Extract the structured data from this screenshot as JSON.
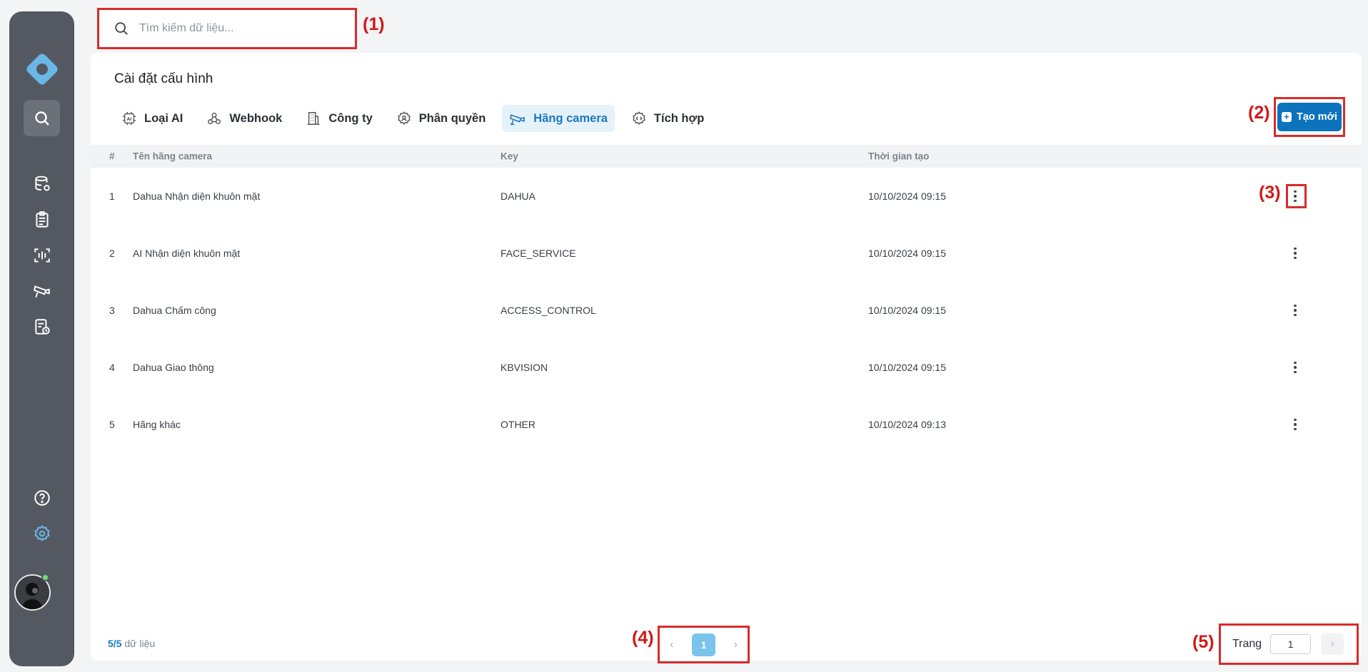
{
  "search": {
    "placeholder": "Tìm kiếm dữ liệu..."
  },
  "annotations": {
    "a1": "(1)",
    "a2": "(2)",
    "a3": "(3)",
    "a4": "(4)",
    "a5": "(5)"
  },
  "page": {
    "title": "Cài đặt cấu hình"
  },
  "tabs": [
    {
      "label": "Loại AI",
      "icon": "ai-chip-icon"
    },
    {
      "label": "Webhook",
      "icon": "webhook-icon"
    },
    {
      "label": "Công ty",
      "icon": "building-icon"
    },
    {
      "label": "Phân quyền",
      "icon": "gear-users-icon"
    },
    {
      "label": "Hãng camera",
      "icon": "camera-icon",
      "active": true
    },
    {
      "label": "Tích hợp",
      "icon": "integration-icon"
    }
  ],
  "create_button": {
    "label": "Tạo mới"
  },
  "table": {
    "headers": {
      "num": "#",
      "name": "Tên hãng camera",
      "key": "Key",
      "time": "Thời gian tạo"
    },
    "rows": [
      {
        "num": "1",
        "name": "Dahua Nhận diện khuôn mặt",
        "key": "DAHUA",
        "time": "10/10/2024 09:15"
      },
      {
        "num": "2",
        "name": "AI Nhận diện khuôn mặt",
        "key": "FACE_SERVICE",
        "time": "10/10/2024 09:15"
      },
      {
        "num": "3",
        "name": "Dahua Chấm công",
        "key": "ACCESS_CONTROL",
        "time": "10/10/2024 09:15"
      },
      {
        "num": "4",
        "name": "Dahua Giao thông",
        "key": "KBVISION",
        "time": "10/10/2024 09:15"
      },
      {
        "num": "5",
        "name": "Hãng khác",
        "key": "OTHER",
        "time": "10/10/2024 09:13"
      }
    ]
  },
  "footer": {
    "count": "5",
    "total": "/5",
    "suffix": " dữ liệu",
    "current_page": "1",
    "goto_label": "Trang",
    "goto_value": "1"
  },
  "colors": {
    "accent": "#0d73bd",
    "sidebar": "#545961",
    "annotation": "#d92b2b"
  }
}
